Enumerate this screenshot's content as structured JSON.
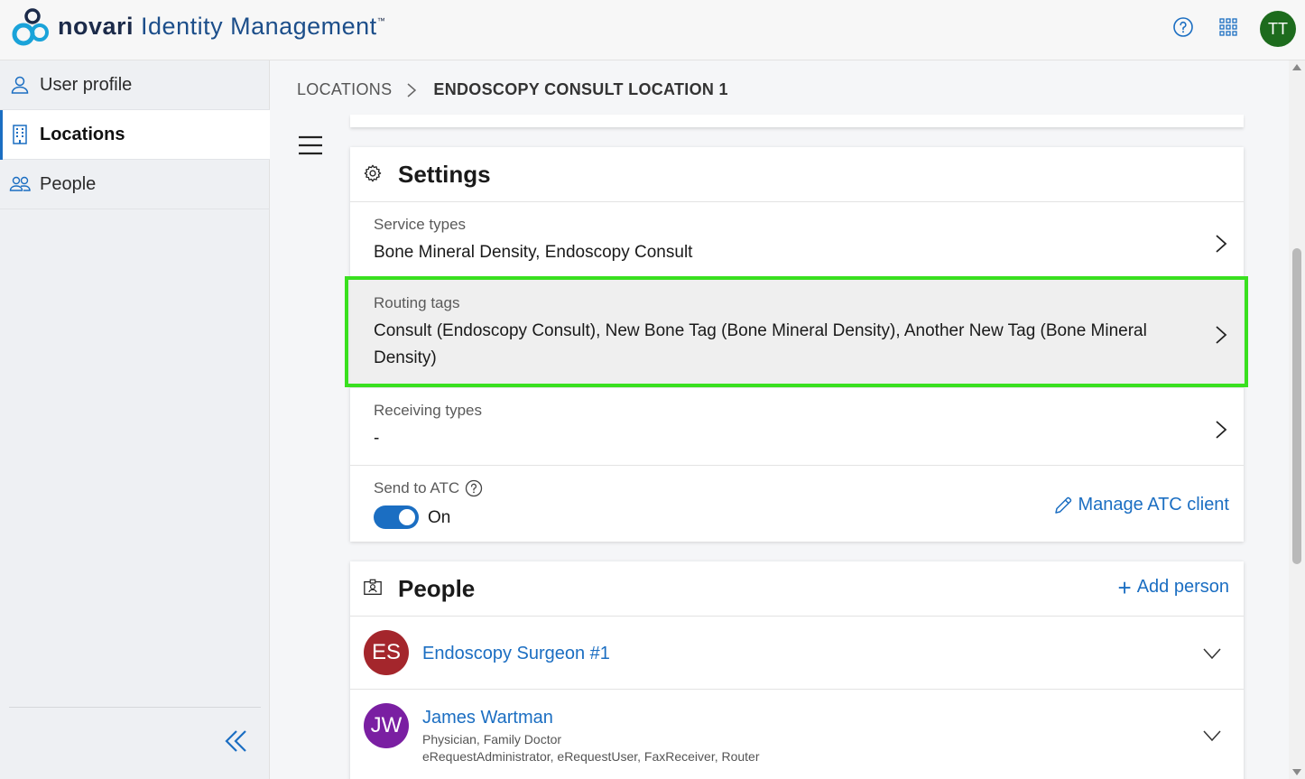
{
  "app": {
    "brand_bold": "novari",
    "brand_rest": "Identity Management",
    "trademark": "™",
    "user_initials": "TT"
  },
  "sidebar": {
    "items": [
      {
        "label": "User profile",
        "icon": "person-icon"
      },
      {
        "label": "Locations",
        "icon": "building-icon",
        "active": true
      },
      {
        "label": "People",
        "icon": "people-icon"
      }
    ]
  },
  "breadcrumb": {
    "root": "LOCATIONS",
    "current": "ENDOSCOPY CONSULT LOCATION 1"
  },
  "settings": {
    "title": "Settings",
    "service_types": {
      "label": "Service types",
      "value": "Bone Mineral Density, Endoscopy Consult"
    },
    "routing_tags": {
      "label": "Routing tags",
      "value": "Consult (Endoscopy Consult), New Bone Tag (Bone Mineral Density), Another New Tag (Bone Mineral Density)"
    },
    "receiving_types": {
      "label": "Receiving types",
      "value": "-"
    },
    "send_to_atc": {
      "label": "Send to ATC",
      "state": "On",
      "enabled": true
    },
    "manage_atc_label": "Manage ATC client"
  },
  "people": {
    "title": "People",
    "add_label": "Add person",
    "list": [
      {
        "initials": "ES",
        "name": "Endoscopy Surgeon #1",
        "avatar_color": "#a4262c"
      },
      {
        "initials": "JW",
        "name": "James Wartman",
        "role": "Physician, Family Doctor",
        "permissions": "eRequestAdministrator, eRequestUser, FaxReceiver, Router",
        "avatar_color": "#7a1fa2"
      }
    ]
  },
  "colors": {
    "accent": "#1b6ec2",
    "highlight": "#39e01f",
    "avatar_tt": "#1d6b1d"
  }
}
